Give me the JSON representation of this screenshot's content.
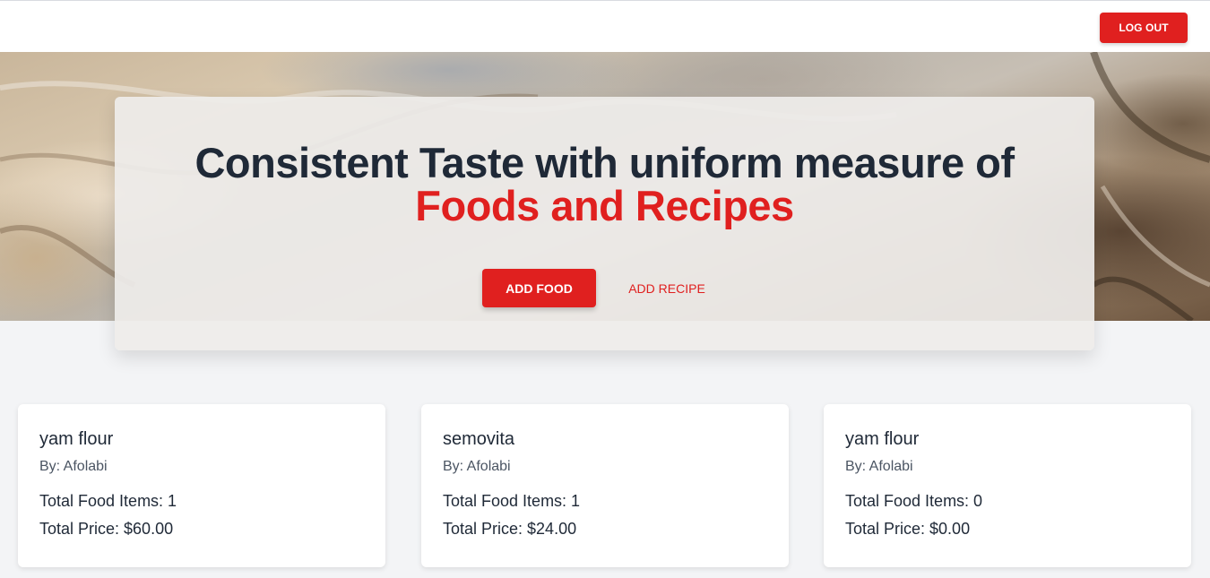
{
  "nav": {
    "logout_label": "LOG OUT"
  },
  "hero": {
    "title_line1": "Consistent Taste with uniform measure of",
    "title_line2": "Foods and Recipes",
    "add_food_label": "ADD FOOD",
    "add_recipe_label": "ADD RECIPE"
  },
  "colors": {
    "accent": "#e0201f",
    "heading": "#1f2937",
    "page_bg": "#f3f4f6"
  },
  "cards": [
    {
      "name": "yam flour",
      "author": "By: Afolabi",
      "total_items": "Total Food Items: 1",
      "total_price": "Total Price: $60.00"
    },
    {
      "name": "semovita",
      "author": "By: Afolabi",
      "total_items": "Total Food Items: 1",
      "total_price": "Total Price: $24.00"
    },
    {
      "name": "yam flour",
      "author": "By: Afolabi",
      "total_items": "Total Food Items: 0",
      "total_price": "Total Price: $0.00"
    }
  ]
}
